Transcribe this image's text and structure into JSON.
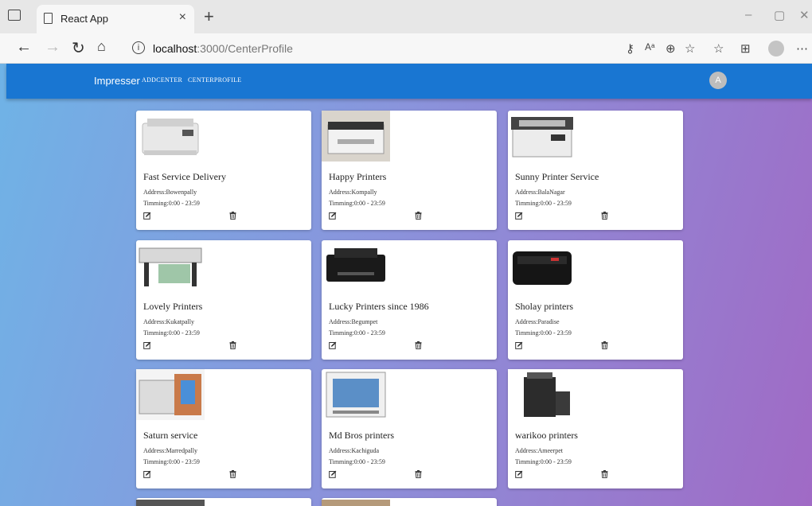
{
  "browser": {
    "tab_title": "React App",
    "tab_close": "×",
    "new_tab": "+",
    "url_host": "localhost",
    "url_path": ":3000/CenterProfile",
    "minimize": "–",
    "maximize": "▢",
    "close": "✕"
  },
  "app": {
    "brand": "Impresser",
    "nav": [
      "ADDCENTER",
      "CENTERPROFILE"
    ],
    "avatar": "A"
  },
  "cards": [
    {
      "title": "Fast Service Delivery",
      "address": "Address:Bowenpally",
      "timing": "Timming:0:00 - 23:59",
      "image": "printer-photo"
    },
    {
      "title": "Happy Printers",
      "address": "Address:Kompally",
      "timing": "Timming:0:00 - 23:59",
      "image": "printer-photo"
    },
    {
      "title": "Sunny Printer Service",
      "address": "Address:BalaNagar",
      "timing": "Timming:0:00 - 23:59",
      "image": "printer-photo"
    },
    {
      "title": "Lovely Printers",
      "address": "Address:Kukatpally",
      "timing": "Timming:0:00 - 23:59",
      "image": "printer-photo"
    },
    {
      "title": "Lucky Printers since 1986",
      "address": "Address:Begumpet",
      "timing": "Timming:0:00 - 23:59",
      "image": "printer-photo"
    },
    {
      "title": "Sholay printers",
      "address": "Address:Paradise",
      "timing": "Timming:0:00 - 23:59",
      "image": "printer-photo"
    },
    {
      "title": "Saturn service",
      "address": "Address:Marredpally",
      "timing": "Timming:0:00 - 23:59",
      "image": "printer-photo"
    },
    {
      "title": "Md Bros printers",
      "address": "Address:Kachiguda",
      "timing": "Timming:0:00 - 23:59",
      "image": "printer-photo"
    },
    {
      "title": "warikoo printers",
      "address": "Address:Ameerpet",
      "timing": "Timming:0:00 - 23:59",
      "image": "printer-photo"
    }
  ],
  "colors": {
    "appbar": "#1976d2",
    "card": "#ffffff"
  }
}
